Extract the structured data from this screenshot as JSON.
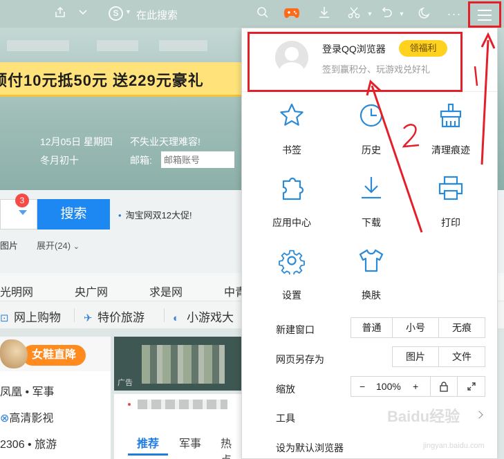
{
  "toolbar": {
    "search_placeholder": "在此搜索",
    "search_engine_glyph": "S",
    "icons": [
      "share-icon",
      "chevron-down-icon",
      "search-engine-icon",
      "search-icon",
      "game-icon",
      "download-icon",
      "scissors-icon",
      "undo-icon",
      "night-mode-icon",
      "more-icon",
      "menu-icon"
    ]
  },
  "page": {
    "banner_text": "预付10元抵50元 送229元豪礼",
    "date": "12月05日 星期四",
    "slogan": "不失业天理难容!",
    "lunar": "冬月初十",
    "mailbox_label": "邮箱:",
    "mailbox_placeholder": "邮箱账号",
    "notification_count": "3",
    "search_button": "搜索",
    "promo": "淘宝网双12大促!",
    "tab_images": "图片",
    "tab_expand": "展开(24)",
    "sites": [
      "光明网",
      "央广网",
      "求是网",
      "中青"
    ],
    "categories": [
      "网上购物",
      "特价旅游",
      "小游戏大"
    ],
    "shoe_banner": "女鞋直降",
    "news_items": [
      "凤凰 • 军事",
      "高清影视",
      "2306 • 旅游"
    ],
    "ad_tag": "广告",
    "news_tabs": [
      "推荐",
      "军事",
      "热点"
    ]
  },
  "panel": {
    "login_title": "登录QQ浏览器",
    "welfare_button": "领福利",
    "login_subtitle": "签到赢积分、玩游戏兑好礼",
    "grid": [
      {
        "label": "书签",
        "icon": "star-icon"
      },
      {
        "label": "历史",
        "icon": "clock-icon"
      },
      {
        "label": "清理痕迹",
        "icon": "broom-icon"
      },
      {
        "label": "应用中心",
        "icon": "puzzle-icon"
      },
      {
        "label": "下载",
        "icon": "download-icon"
      },
      {
        "label": "打印",
        "icon": "printer-icon"
      },
      {
        "label": "设置",
        "icon": "gear-icon"
      },
      {
        "label": "换肤",
        "icon": "shirt-icon"
      }
    ],
    "new_window": {
      "label": "新建窗口",
      "options": [
        "普通",
        "小号",
        "无痕"
      ]
    },
    "save_as": {
      "label": "网页另存为",
      "options": [
        "图片",
        "文件"
      ]
    },
    "zoom": {
      "label": "缩放",
      "minus": "−",
      "value": "100%",
      "plus": "+"
    },
    "tools": {
      "label": "工具"
    },
    "default_browser": {
      "label": "设为默认浏览器"
    }
  },
  "annotations": {
    "arrow_1_label": "1",
    "arrow_2_label": "2",
    "color": "#e3202a"
  },
  "watermark": {
    "text": "Baidu经验",
    "sub": "jingyan.baidu.com"
  }
}
